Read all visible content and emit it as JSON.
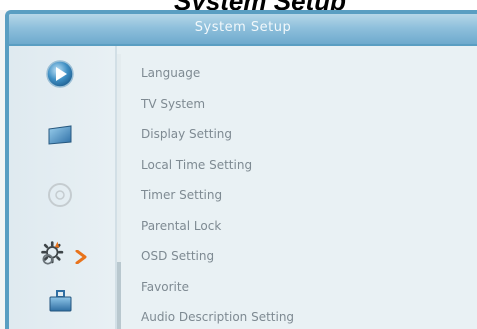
{
  "window": {
    "overlay_text": "System Setup",
    "title": "System Setup"
  },
  "sidebar": {
    "icons": [
      {
        "name": "play-icon",
        "selected": false
      },
      {
        "name": "tv-screen-icon",
        "selected": false
      },
      {
        "name": "disc-icon",
        "selected": false
      },
      {
        "name": "settings-gear-icon",
        "selected": true
      },
      {
        "name": "toolbox-icon",
        "selected": false
      }
    ]
  },
  "menu": {
    "items": [
      {
        "label": "Language"
      },
      {
        "label": "TV System"
      },
      {
        "label": "Display Setting"
      },
      {
        "label": "Local Time Setting"
      },
      {
        "label": "Timer Setting"
      },
      {
        "label": "Parental Lock"
      },
      {
        "label": "OSD Setting"
      },
      {
        "label": "Favorite"
      },
      {
        "label": "Audio Description Setting"
      }
    ]
  },
  "colors": {
    "panel_border": "#5a9ec2",
    "header_gradient_mid": "#8fc0dc",
    "panel_bg": "#e9f1f4",
    "menu_text": "#7e8a92",
    "selection_arrow": "#e8731c"
  }
}
